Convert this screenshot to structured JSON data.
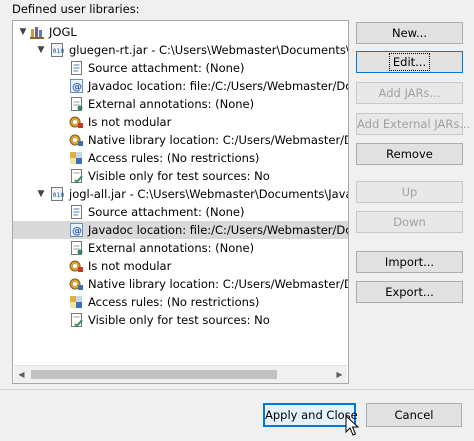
{
  "header": {
    "label": "Defined user libraries:"
  },
  "tree": {
    "library": {
      "name": "JOGL",
      "icon": "library-icon"
    },
    "jars": [
      {
        "name": "gluegen-rt.jar - C:\\Users\\Webmaster\\Documents\\JavaOp",
        "icon": "jar-icon",
        "children": [
          {
            "label": "Source attachment: (None)",
            "icon": "source-attachment-icon"
          },
          {
            "label": "Javadoc location: file:/C:/Users/Webmaster/Docum",
            "icon": "javadoc-icon"
          },
          {
            "label": "External annotations: (None)",
            "icon": "external-annotations-icon"
          },
          {
            "label": "Is not modular",
            "icon": "module-icon"
          },
          {
            "label": "Native library location: C:/Users/Webmaster/Docu",
            "icon": "native-library-icon"
          },
          {
            "label": "Access rules: (No restrictions)",
            "icon": "access-rules-icon"
          },
          {
            "label": "Visible only for test sources: No",
            "icon": "test-sources-icon"
          }
        ]
      },
      {
        "name": "jogl-all.jar - C:\\Users\\Webmaster\\Documents\\JavaOp",
        "icon": "jar-icon",
        "children": [
          {
            "label": "Source attachment: (None)",
            "icon": "source-attachment-icon"
          },
          {
            "label": "Javadoc location: file:/C:/Users/Webmaster/Docum",
            "icon": "javadoc-icon"
          },
          {
            "label": "External annotations: (None)",
            "icon": "external-annotations-icon"
          },
          {
            "label": "Is not modular",
            "icon": "module-icon"
          },
          {
            "label": "Native library location: C:/Users/Webmaster/Docu",
            "icon": "native-library-icon"
          },
          {
            "label": "Access rules: (No restrictions)",
            "icon": "access-rules-icon"
          },
          {
            "label": "Visible only for test sources: No",
            "icon": "test-sources-icon"
          }
        ]
      }
    ]
  },
  "buttons": {
    "new": "New...",
    "edit": "Edit...",
    "add_jars": "Add JARs...",
    "add_external_jars": "Add External JARs...",
    "remove": "Remove",
    "up": "Up",
    "down": "Down",
    "import": "Import...",
    "export": "Export..."
  },
  "footer": {
    "apply_close": "Apply and Close",
    "cancel": "Cancel"
  },
  "colors": {
    "focus_blue": "#0078d7",
    "selection_gray": "#d9d9d9",
    "disabled_text": "#a0a0a0"
  }
}
